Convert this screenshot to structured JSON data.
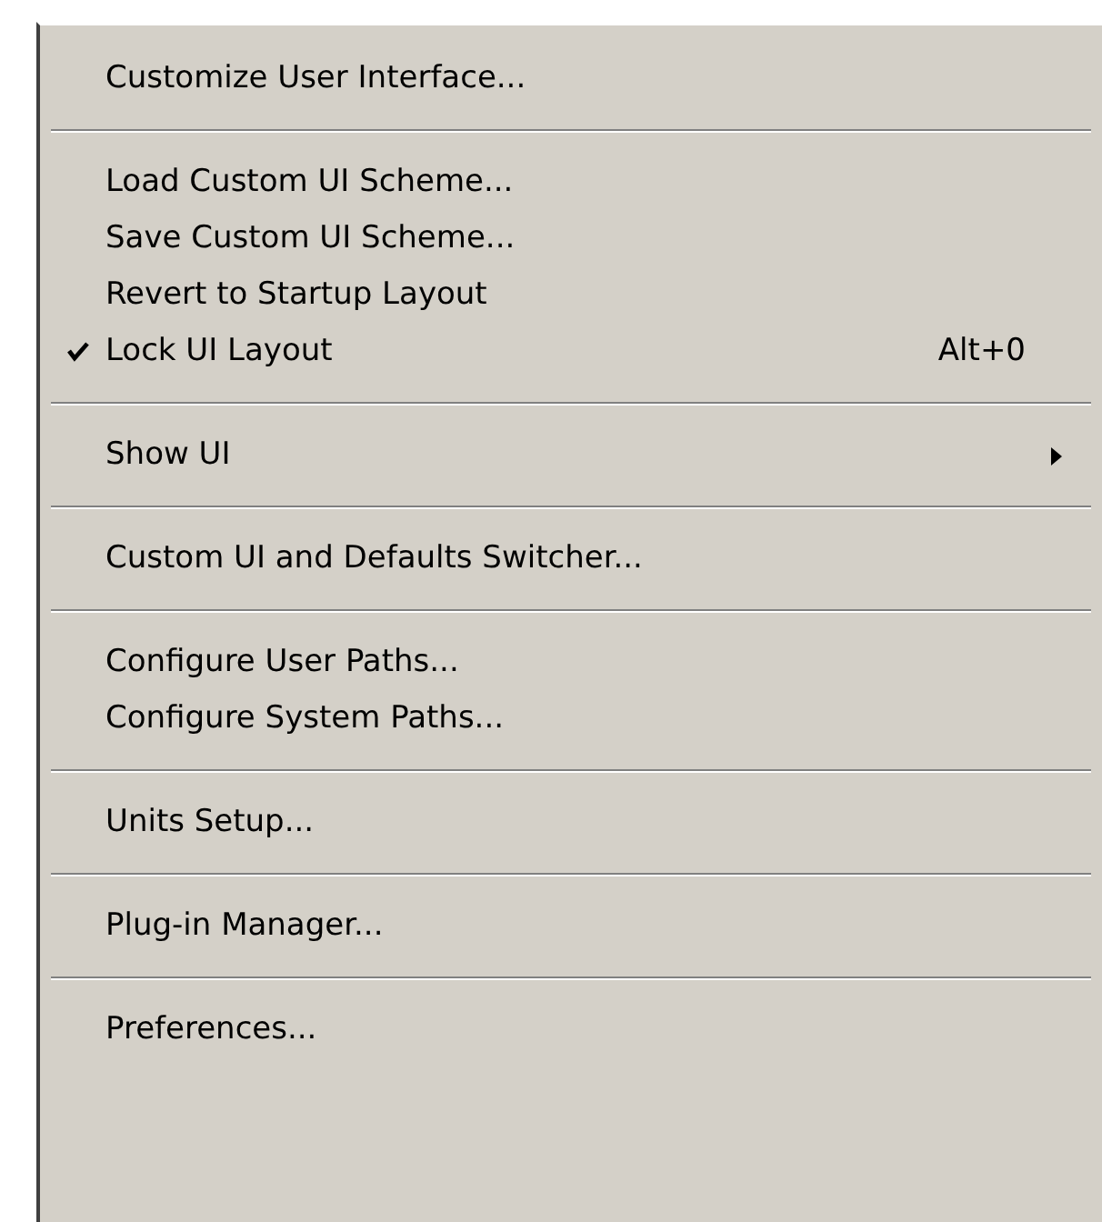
{
  "menu": {
    "items": [
      {
        "kind": "item",
        "label": "Customize User Interface...",
        "checked": false,
        "submenu": false
      },
      {
        "kind": "separator"
      },
      {
        "kind": "item",
        "label": "Load Custom UI Scheme...",
        "checked": false,
        "submenu": false
      },
      {
        "kind": "item",
        "label": "Save Custom UI Scheme...",
        "checked": false,
        "submenu": false
      },
      {
        "kind": "item",
        "label": "Revert to Startup Layout",
        "checked": false,
        "submenu": false
      },
      {
        "kind": "item",
        "label": "Lock UI Layout",
        "checked": true,
        "submenu": false,
        "shortcut": "Alt+0"
      },
      {
        "kind": "separator"
      },
      {
        "kind": "item",
        "label": "Show UI",
        "checked": false,
        "submenu": true
      },
      {
        "kind": "separator"
      },
      {
        "kind": "item",
        "label": "Custom UI and Defaults Switcher...",
        "checked": false,
        "submenu": false
      },
      {
        "kind": "separator"
      },
      {
        "kind": "item",
        "label": "Configure User Paths...",
        "checked": false,
        "submenu": false
      },
      {
        "kind": "item",
        "label": "Configure System Paths...",
        "checked": false,
        "submenu": false
      },
      {
        "kind": "separator"
      },
      {
        "kind": "item",
        "label": "Units Setup...",
        "checked": false,
        "submenu": false
      },
      {
        "kind": "separator"
      },
      {
        "kind": "item",
        "label": "Plug-in Manager...",
        "checked": false,
        "submenu": false
      },
      {
        "kind": "separator"
      },
      {
        "kind": "item",
        "label": "Preferences...",
        "checked": false,
        "submenu": false
      }
    ]
  }
}
